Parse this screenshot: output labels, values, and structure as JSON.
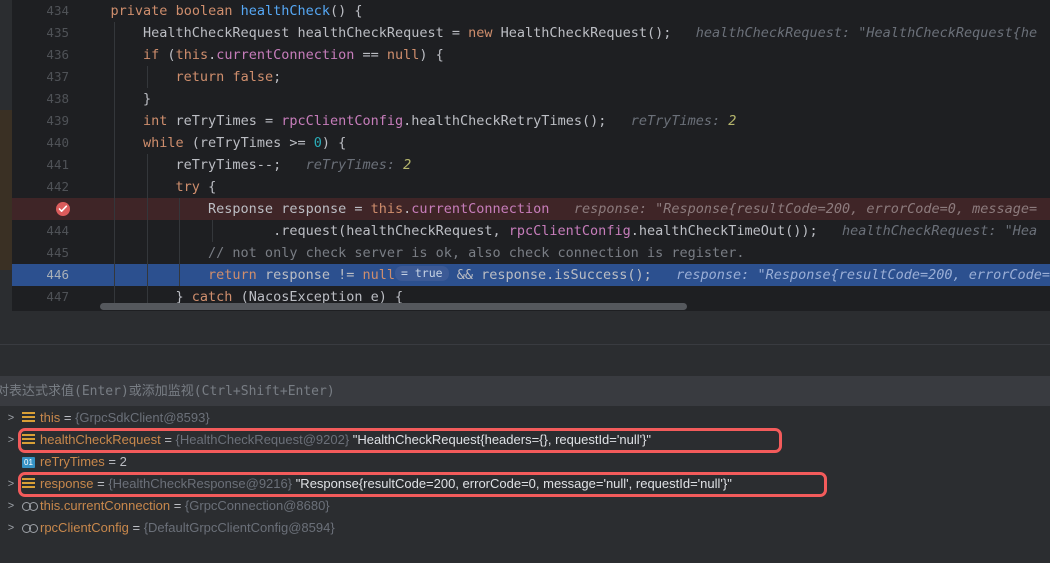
{
  "editor": {
    "breakpoint_icon": "breakpoint-checked-icon",
    "lines": [
      {
        "num": "434",
        "indent_guides": 0,
        "state": "normal",
        "tokens": [
          {
            "t": "    ",
            "c": "pln"
          },
          {
            "t": "private",
            "c": "kw"
          },
          {
            "t": " ",
            "c": "pln"
          },
          {
            "t": "boolean",
            "c": "kw"
          },
          {
            "t": " ",
            "c": "pln"
          },
          {
            "t": "healthCheck",
            "c": "mth"
          },
          {
            "t": "() {",
            "c": "pln"
          }
        ],
        "hint": "",
        "hint_value": ""
      },
      {
        "num": "435",
        "indent_guides": 1,
        "state": "normal",
        "tokens": [
          {
            "t": "        HealthCheckRequest healthCheckRequest = ",
            "c": "pln"
          },
          {
            "t": "new",
            "c": "kw"
          },
          {
            "t": " HealthCheckRequest();",
            "c": "pln"
          }
        ],
        "hint": "healthCheckRequest: ",
        "hint_value": "\"HealthCheckRequest{he"
      },
      {
        "num": "436",
        "indent_guides": 1,
        "state": "normal",
        "tokens": [
          {
            "t": "        ",
            "c": "pln"
          },
          {
            "t": "if",
            "c": "kw"
          },
          {
            "t": " (",
            "c": "pln"
          },
          {
            "t": "this",
            "c": "kw"
          },
          {
            "t": ".",
            "c": "pln"
          },
          {
            "t": "currentConnection",
            "c": "fld"
          },
          {
            "t": " == ",
            "c": "pln"
          },
          {
            "t": "null",
            "c": "kw"
          },
          {
            "t": ") {",
            "c": "pln"
          }
        ],
        "hint": "",
        "hint_value": ""
      },
      {
        "num": "437",
        "indent_guides": 2,
        "state": "normal",
        "tokens": [
          {
            "t": "            ",
            "c": "pln"
          },
          {
            "t": "return",
            "c": "kw"
          },
          {
            "t": " ",
            "c": "pln"
          },
          {
            "t": "false",
            "c": "kw"
          },
          {
            "t": ";",
            "c": "pln"
          }
        ],
        "hint": "",
        "hint_value": ""
      },
      {
        "num": "438",
        "indent_guides": 1,
        "state": "normal",
        "tokens": [
          {
            "t": "        }",
            "c": "pln"
          }
        ],
        "hint": "",
        "hint_value": ""
      },
      {
        "num": "439",
        "indent_guides": 1,
        "state": "normal",
        "tokens": [
          {
            "t": "        ",
            "c": "pln"
          },
          {
            "t": "int",
            "c": "kw"
          },
          {
            "t": " reTryTimes = ",
            "c": "pln"
          },
          {
            "t": "rpcClientConfig",
            "c": "fld"
          },
          {
            "t": ".healthCheckRetryTimes();",
            "c": "pln"
          }
        ],
        "hint": "reTryTimes: ",
        "hint_value": "2"
      },
      {
        "num": "440",
        "indent_guides": 1,
        "state": "normal",
        "tokens": [
          {
            "t": "        ",
            "c": "pln"
          },
          {
            "t": "while",
            "c": "kw"
          },
          {
            "t": " (reTryTimes >= ",
            "c": "pln"
          },
          {
            "t": "0",
            "c": "num"
          },
          {
            "t": ") {",
            "c": "pln"
          }
        ],
        "hint": "",
        "hint_value": ""
      },
      {
        "num": "441",
        "indent_guides": 2,
        "state": "normal",
        "tokens": [
          {
            "t": "            reTryTimes--;",
            "c": "pln"
          }
        ],
        "hint": "reTryTimes: ",
        "hint_value": "2"
      },
      {
        "num": "442",
        "indent_guides": 2,
        "state": "normal",
        "tokens": [
          {
            "t": "            ",
            "c": "pln"
          },
          {
            "t": "try",
            "c": "kw"
          },
          {
            "t": " {",
            "c": "pln"
          }
        ],
        "hint": "",
        "hint_value": ""
      },
      {
        "num": "443",
        "indent_guides": 3,
        "state": "breakpoint",
        "tokens": [
          {
            "t": "                Response response = ",
            "c": "pln"
          },
          {
            "t": "this",
            "c": "kw"
          },
          {
            "t": ".",
            "c": "pln"
          },
          {
            "t": "currentConnection",
            "c": "fld"
          }
        ],
        "hint": "response: ",
        "hint_value": "\"Response{resultCode=200, errorCode=0, message="
      },
      {
        "num": "444",
        "indent_guides": 4,
        "state": "normal",
        "tokens": [
          {
            "t": "                        .request(healthCheckRequest, ",
            "c": "pln"
          },
          {
            "t": "rpcClientConfig",
            "c": "fld"
          },
          {
            "t": ".healthCheckTimeOut());",
            "c": "pln"
          }
        ],
        "hint": "healthCheckRequest: ",
        "hint_value": "\"Hea"
      },
      {
        "num": "445",
        "indent_guides": 3,
        "state": "normal",
        "tokens": [
          {
            "t": "                // not only check server is ok, also check connection is register.",
            "c": "cmt"
          }
        ],
        "hint": "",
        "hint_value": ""
      },
      {
        "num": "446",
        "indent_guides": 3,
        "state": "execution",
        "tokens": [
          {
            "t": "                ",
            "c": "pln"
          },
          {
            "t": "return",
            "c": "kw"
          },
          {
            "t": " response != ",
            "c": "pln"
          },
          {
            "t": "null",
            "c": "kw"
          }
        ],
        "pill": "= true",
        "tokens_after": [
          {
            "t": " && response.isSuccess();",
            "c": "pln"
          }
        ],
        "hint": "response: ",
        "hint_value": "\"Response{resultCode=200, errorCode="
      },
      {
        "num": "447",
        "indent_guides": 2,
        "state": "normal",
        "tokens": [
          {
            "t": "            } ",
            "c": "pln"
          },
          {
            "t": "catch",
            "c": "kw"
          },
          {
            "t": " (NacosException e) {",
            "c": "pln"
          }
        ],
        "hint": "",
        "hint_value": ""
      }
    ],
    "scrollbar": "horizontal-scrollbar"
  },
  "watch": {
    "placeholder": "对表达式求值(Enter)或添加监视(Ctrl+Shift+Enter)"
  },
  "variables": {
    "rows": [
      {
        "twisty": ">",
        "icon": "object-icon",
        "name": "this",
        "eq": " = ",
        "ref": "{GrpcSdkClient@8593}",
        "value": "",
        "highlight": false
      },
      {
        "twisty": ">",
        "icon": "object-icon",
        "name": "healthCheckRequest",
        "eq": " = ",
        "ref": "{HealthCheckRequest@9202}",
        "value": "\"HealthCheckRequest{headers={}, requestId='null'}\"",
        "highlight": true
      },
      {
        "twisty": "",
        "icon": "primitive-icon",
        "name": "reTryTimes",
        "eq": " = ",
        "ref": "",
        "value": "2",
        "value_kind": "num",
        "highlight": false
      },
      {
        "twisty": ">",
        "icon": "object-icon",
        "name": "response",
        "eq": " = ",
        "ref": "{HealthCheckResponse@9216}",
        "value": "\"Response{resultCode=200, errorCode=0, message='null', requestId='null'}\"",
        "highlight": true
      },
      {
        "twisty": ">",
        "icon": "field-icon",
        "name": "this.currentConnection",
        "eq": " = ",
        "ref": "{GrpcConnection@8680}",
        "value": "",
        "highlight": false
      },
      {
        "twisty": ">",
        "icon": "field-icon",
        "name": "rpcClientConfig",
        "eq": " = ",
        "ref": "{DefaultGrpcClientConfig@8594}",
        "value": "",
        "highlight": false
      }
    ]
  },
  "colors": {
    "execution_line": "#2c508f",
    "breakpoint_line": "#3f2527",
    "annotation_box": "#f35b5b",
    "keyword": "#cf8e6d",
    "method": "#56a8f5",
    "field": "#c77dbb",
    "comment": "#7a7e85",
    "variable_name": "#c8884c"
  }
}
